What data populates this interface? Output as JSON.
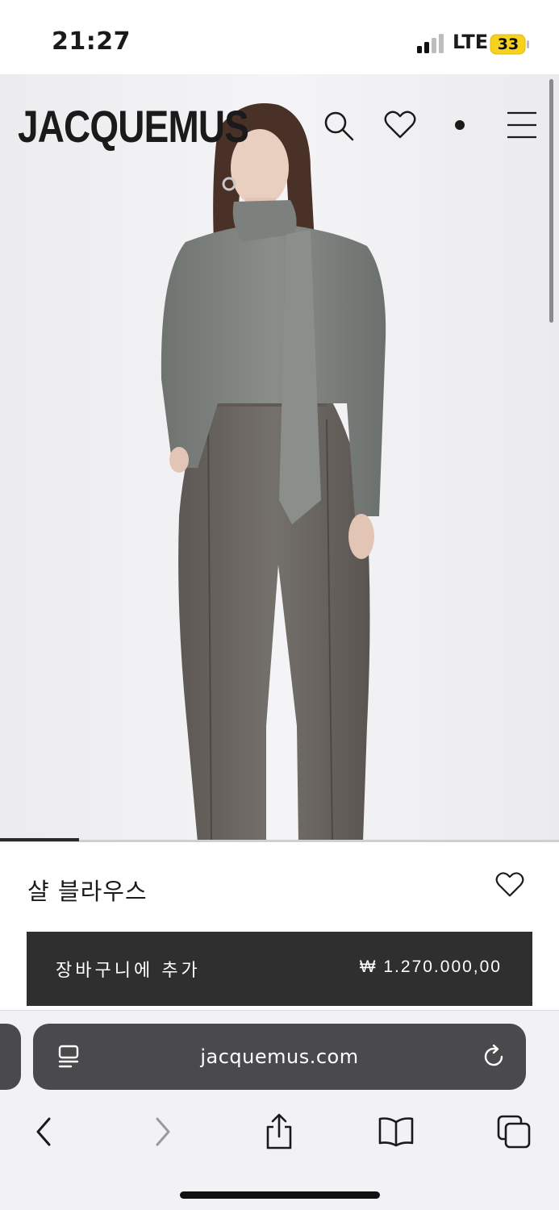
{
  "status_bar": {
    "time": "21:27",
    "carrier": "LTE",
    "battery_level": "33",
    "battery_color": "#f6d21d"
  },
  "header": {
    "brand": "JACQUEMUS",
    "icons": [
      "search-icon",
      "heart-icon",
      "dot-icon",
      "menu-icon"
    ]
  },
  "product": {
    "name": "샬 블라우스",
    "add_to_cart_label": "장바구니에 추가",
    "price": "₩ 1.270.000,00"
  },
  "browser": {
    "url": "jacquemus.com",
    "toolbar_icons": [
      "back-icon",
      "forward-icon",
      "share-icon",
      "bookmarks-icon",
      "tabs-icon"
    ]
  },
  "colors": {
    "button_bg": "#2f2f2f",
    "url_bar_bg": "#4a4a4c",
    "image_bg": "#efeff1"
  }
}
